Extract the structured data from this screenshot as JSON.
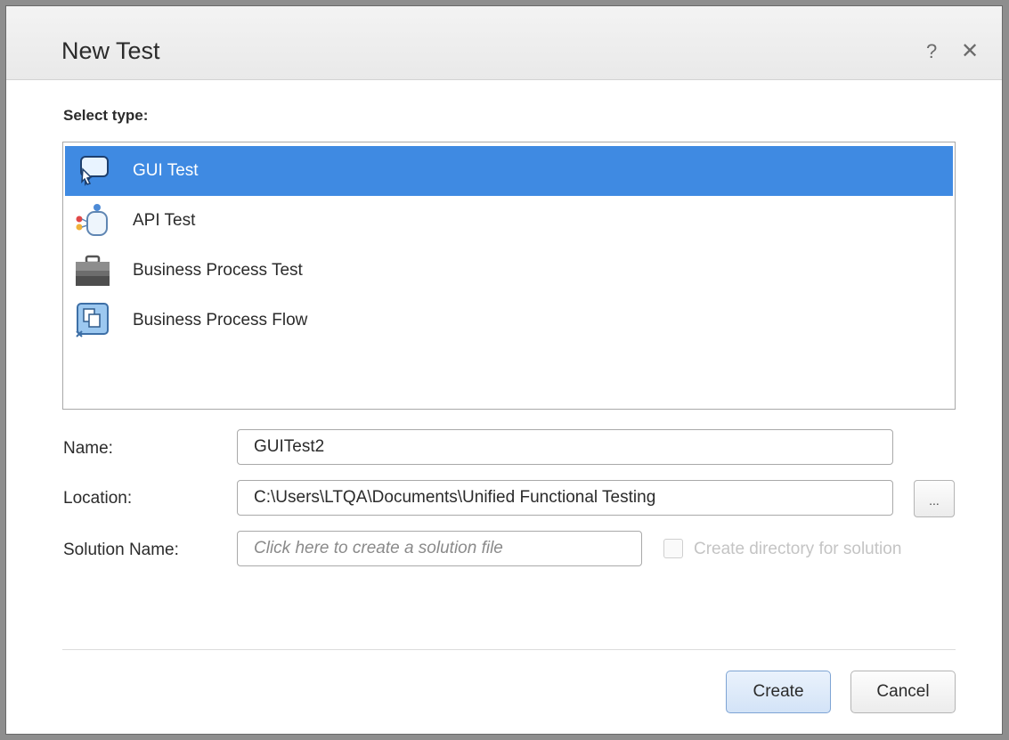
{
  "dialog": {
    "title": "New Test",
    "help_label": "?",
    "close_label": "✕"
  },
  "select_type": {
    "label": "Select type:",
    "items": [
      {
        "label": "GUI Test",
        "icon": "gui-test-icon",
        "selected": true
      },
      {
        "label": "API Test",
        "icon": "api-test-icon",
        "selected": false
      },
      {
        "label": "Business Process Test",
        "icon": "briefcase-icon",
        "selected": false
      },
      {
        "label": "Business Process Flow",
        "icon": "process-flow-icon",
        "selected": false
      }
    ]
  },
  "form": {
    "name_label": "Name:",
    "name_value": "GUITest2",
    "location_label": "Location:",
    "location_value": "C:\\Users\\LTQA\\Documents\\Unified Functional Testing",
    "browse_label": "...",
    "solution_label": "Solution Name:",
    "solution_placeholder": "Click here to create a solution file",
    "create_dir_label": "Create directory for solution"
  },
  "buttons": {
    "create": "Create",
    "cancel": "Cancel"
  },
  "colors": {
    "selection": "#3f8ae2",
    "create_button": "#d3e3f7"
  }
}
